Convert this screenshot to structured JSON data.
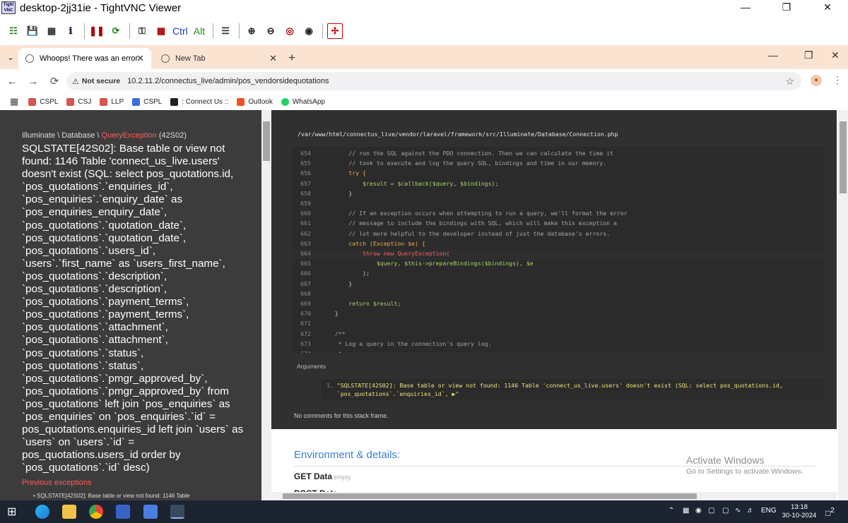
{
  "vnc": {
    "title": "desktop-2jj31ie - TightVNC Viewer",
    "ctrl_label": "Ctrl",
    "alt_label": "Alt"
  },
  "tabs": [
    {
      "label": "Whoops! There was an error."
    },
    {
      "label": "New Tab"
    }
  ],
  "address": {
    "not_secure": "Not secure",
    "url": "10.2.11.2/connectus_live/admin/pos_vendorsidequotations"
  },
  "bookmarks": [
    {
      "label": "CSPL",
      "color": "#d9534f"
    },
    {
      "label": "CSJ",
      "color": "#d9534f"
    },
    {
      "label": "LLP",
      "color": "#d9534f"
    },
    {
      "label": "CSPL",
      "color": "#3a6fd8"
    },
    {
      "label": ": Connect Us ::",
      "color": "#222222"
    },
    {
      "label": "Outlook",
      "color": "#f25022"
    },
    {
      "label": "WhatsApp",
      "color": "#25d366"
    }
  ],
  "error": {
    "namespace_prefix": "Illuminate \\ Database \\ ",
    "exception": "QueryException",
    "code": " (42S02)",
    "message": "SQLSTATE[42S02]: Base table or view not found: 1146 Table 'connect_us_live.users' doesn't exist (SQL: select pos_quotations.id, `pos_quotations`.`enquiries_id`, `pos_enquiries`.`enquiry_date` as `pos_enquiries_enquiry_date`, `pos_quotations`.`quotation_date`, `pos_quotations`.`quotation_date`, `pos_quotations`.`users_id`, `users`.`first_name` as `users_first_name`, `pos_quotations`.`description`, `pos_quotations`.`description`, `pos_quotations`.`payment_terms`, `pos_quotations`.`payment_terms`, `pos_quotations`.`attachment`, `pos_quotations`.`attachment`, `pos_quotations`.`status`, `pos_quotations`.`status`, `pos_quotations`.`pmgr_approved_by`, `pos_quotations`.`pmgr_approved_by` from `pos_quotations` left join `pos_enquiries` as `pos_enquiries` on `pos_enquiries`.`id` = pos_quotations.enquiries_id left join `users` as `users` on `users`.`id` = pos_quotations.users_id order by `pos_quotations`.`id` desc)",
    "previous_label": "Previous exceptions",
    "previous_item": "SQLSTATE[42S02]: Base table or view not found: 1146 Table"
  },
  "stack": {
    "file_path": "/var/www/html/connectus_live/vendor/laravel/framework/src/Illuminate/Database/Connection.php",
    "lines": [
      {
        "n": "654",
        "t": "        // run the SQL against the PDO connection. Then we can calculate the time it",
        "c": "comment"
      },
      {
        "n": "655",
        "t": "        // took to execute and log the query SQL, bindings and time in our memory.",
        "c": "comment"
      },
      {
        "n": "656",
        "t": "        try {",
        "c": "kw"
      },
      {
        "n": "657",
        "t": "            $result = $callback($query, $bindings);",
        "c": "var-name"
      },
      {
        "n": "658",
        "t": "        }",
        "c": ""
      },
      {
        "n": "659",
        "t": "",
        "c": ""
      },
      {
        "n": "660",
        "t": "        // If an exception occurs when attempting to run a query, we'll format the error",
        "c": "comment"
      },
      {
        "n": "661",
        "t": "        // message to include the bindings with SQL, which will make this exception a",
        "c": "comment"
      },
      {
        "n": "662",
        "t": "        // lot more helpful to the developer instead of just the database's errors.",
        "c": "comment"
      },
      {
        "n": "663",
        "t": "        catch (Exception $e) {",
        "c": "kw"
      },
      {
        "n": "664",
        "t": "            throw new QueryException(",
        "c": "hlred"
      },
      {
        "n": "665",
        "t": "                $query, $this->prepareBindings($bindings), $e",
        "c": "var-name"
      },
      {
        "n": "666",
        "t": "            );",
        "c": ""
      },
      {
        "n": "667",
        "t": "        }",
        "c": ""
      },
      {
        "n": "668",
        "t": "",
        "c": ""
      },
      {
        "n": "669",
        "t": "        return $result;",
        "c": "var-name"
      },
      {
        "n": "670",
        "t": "    }",
        "c": ""
      },
      {
        "n": "671",
        "t": "",
        "c": ""
      },
      {
        "n": "672",
        "t": "    /**",
        "c": "comment"
      },
      {
        "n": "673",
        "t": "     * Log a query in the connection's query log.",
        "c": "comment"
      },
      {
        "n": "674",
        "t": "     *",
        "c": "comment"
      }
    ],
    "arguments_label": "Arguments",
    "argument_index": "1.",
    "argument_line1": "\"SQLSTATE[42S02]: Base table or view not found: 1146 Table 'connect_us_live.users' doesn't exist (SQL: select pos_quotations.id,",
    "argument_line2": " `pos_quotations`.`enquiries_id`, ▶\"",
    "no_comments": "No comments for this stack frame."
  },
  "env": {
    "title": "Environment & details:",
    "get_data": "GET Data",
    "get_empty": "empty",
    "post_data": "POST Data"
  },
  "watermark": {
    "line1": "Activate Windows",
    "line2": "Go to Settings to activate Windows."
  },
  "taskbar": {
    "lang": "ENG",
    "time": "13:18",
    "date": "30-10-2024",
    "notifications": "2"
  }
}
